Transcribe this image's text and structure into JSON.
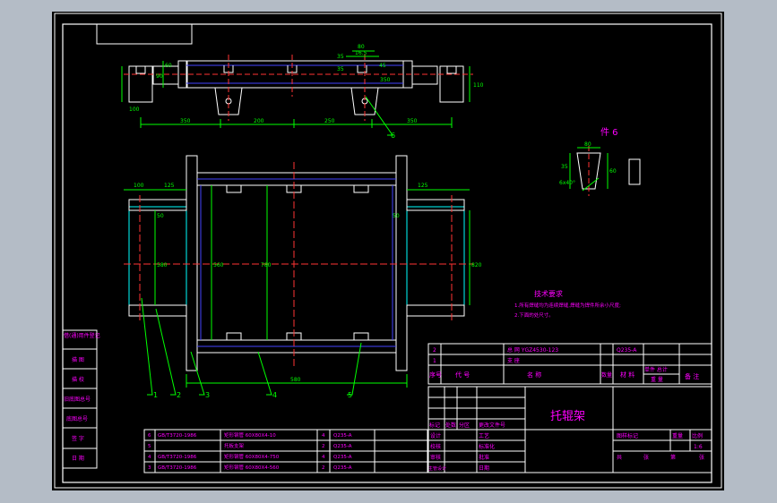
{
  "colors": {
    "background": "#000000",
    "viewport": "#b4bcc6",
    "frame": "#ffffff",
    "border_line": "#00ffff",
    "dimension": "#00ff00",
    "center_line": "#ff3333",
    "hidden_line": "#4444ff",
    "note_text": "#ff00ff",
    "title_text": "#ff00ff",
    "leader": "#00ff00"
  },
  "dimensions": {
    "top_view": [
      "80",
      "16.5",
      "45",
      "35",
      "35",
      "90",
      "100",
      "110",
      "350",
      "250",
      "350",
      "200",
      "350",
      "60"
    ],
    "plan_view": [
      "100",
      "125",
      "125",
      "50",
      "50",
      "580",
      "780",
      "820",
      "560",
      "580"
    ]
  },
  "part6": {
    "title": "件 6",
    "dims": [
      "80",
      "35",
      "60",
      "6x40°"
    ]
  },
  "notes": {
    "title": "技术要求",
    "lines": [
      "1.所有焊缝均为连续焊缝,焊缝为焊件所余小尺度;",
      "2.下面的处尺寸。"
    ]
  },
  "leaders": [
    "1",
    "2",
    "3",
    "4",
    "5",
    "6"
  ],
  "left_strip": [
    "借(通)用件登记",
    "描  图",
    "描  校",
    "旧底图总号",
    "底图总号",
    "签  字",
    "日  期"
  ],
  "bom": {
    "rows": [
      {
        "no": "2",
        "code": "",
        "name": "总 网 YGZ4530-123",
        "qty": "",
        "material": "Q235-A",
        "weight": "",
        "remark": ""
      },
      {
        "no": "1",
        "code": "",
        "name": "支 座",
        "qty": "",
        "material": "",
        "weight": "",
        "remark": ""
      }
    ],
    "header": {
      "no": "序号",
      "code": "代 号",
      "name": "名   称",
      "qty": "数量",
      "material": "材 料",
      "weight_top": "单件 总计",
      "weight_bottom": "重 量",
      "remark": "备 注"
    }
  },
  "parts_list": [
    {
      "no": "6",
      "code": "GB/T3720-1986",
      "name": "矩形钢管 60X80X4-10",
      "qty": "4",
      "material": "Q235-A"
    },
    {
      "no": "5",
      "code": "",
      "name": "托板支架",
      "qty": "2",
      "material": "Q235-A"
    },
    {
      "no": "4",
      "code": "GB/T3720-1986",
      "name": "矩形钢管 60X80X4-750",
      "qty": "4",
      "material": "Q235-A"
    },
    {
      "no": "3",
      "code": "GB/T3720-1986",
      "name": "矩形钢管 60X80X4-560",
      "qty": "2",
      "material": "Q235-A"
    }
  ],
  "title_block": {
    "drawing_name": "托辊架",
    "row_labels": [
      "标记",
      "处数",
      "分区",
      "更改文件号",
      "签名",
      "年月日"
    ],
    "left_labels": [
      "设计",
      "校核",
      "审核",
      "主管设计"
    ],
    "mid_labels": [
      "工艺",
      "标准化",
      "批准",
      "日期"
    ],
    "right_top": [
      "图样标记",
      "重量",
      "比例"
    ],
    "scale": "1:6",
    "right_bottom": [
      "共",
      "张",
      "第",
      "张"
    ]
  }
}
